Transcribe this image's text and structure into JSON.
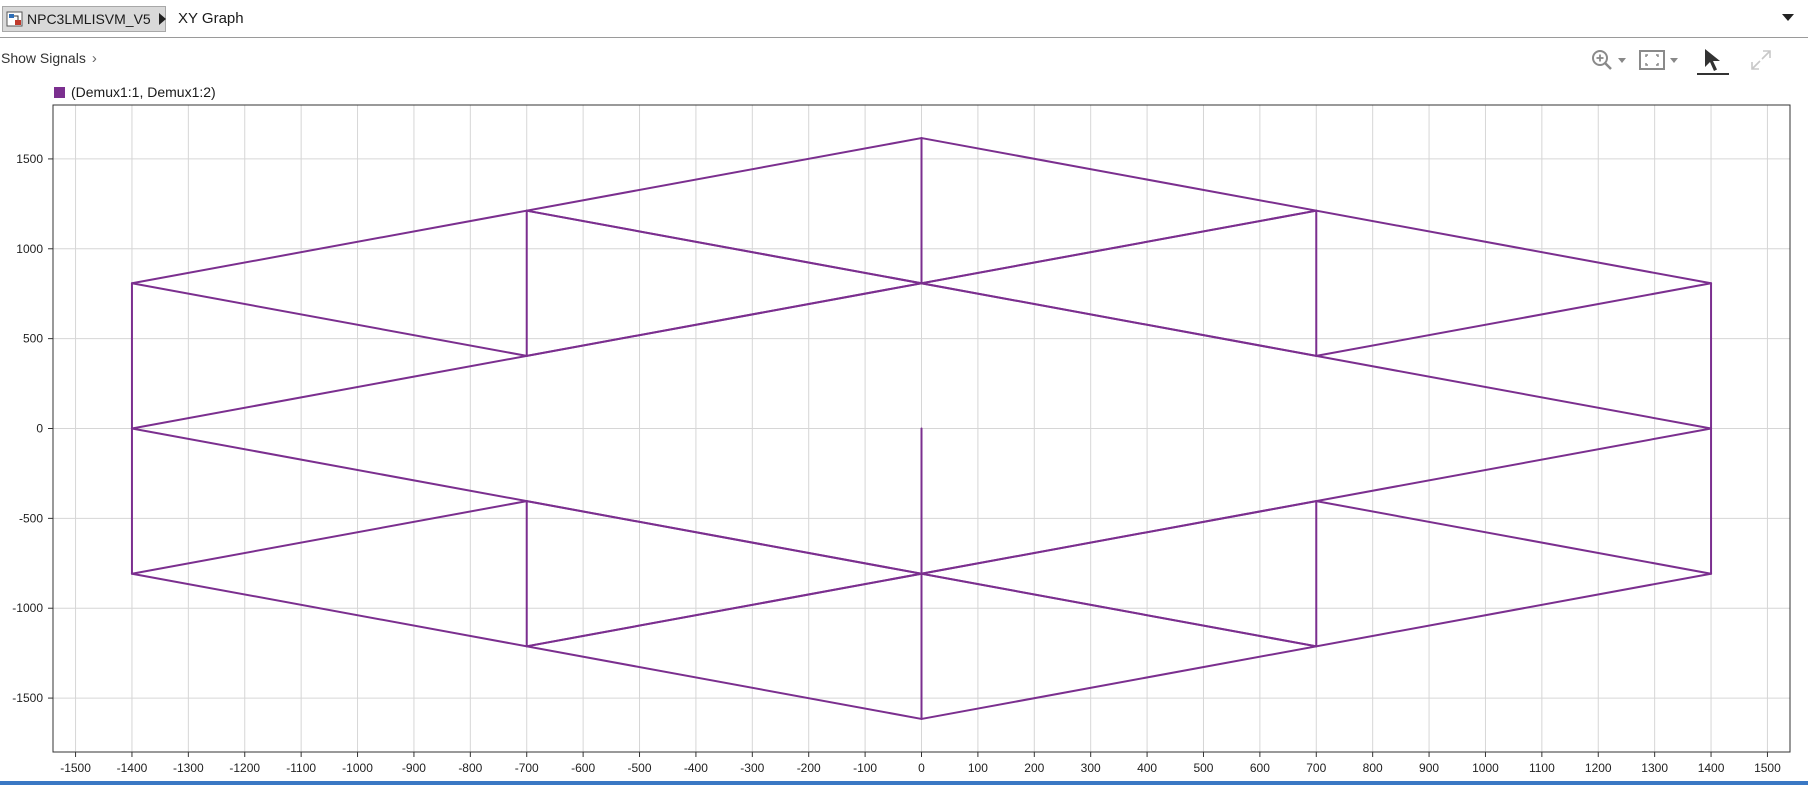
{
  "breadcrumb": {
    "model": "NPC3LMLISVM_V5",
    "block": "XY Graph"
  },
  "toolbar": {
    "show_signals": "Show Signals",
    "chevron": "›",
    "icons": [
      "zoom-in-icon",
      "fit-to-view-icon",
      "pointer-icon",
      "expand-icon"
    ]
  },
  "legend": {
    "label": "(Demux1:1, Demux1:2)",
    "color": "#7b2f8f"
  },
  "colors": {
    "plot_line": "#7b2f8f",
    "grid": "#d6d6d6",
    "accent_bottom": "#3a78c4"
  },
  "chart_data": {
    "type": "line",
    "title": "",
    "xlabel": "",
    "ylabel": "",
    "xlim": [
      -1540,
      1540
    ],
    "ylim": [
      -1800,
      1800
    ],
    "xticks": [
      -1500,
      -1400,
      -1300,
      -1200,
      -1100,
      -1000,
      -900,
      -800,
      -700,
      -600,
      -500,
      -400,
      -300,
      -200,
      -100,
      0,
      100,
      200,
      300,
      400,
      500,
      600,
      700,
      800,
      900,
      1000,
      1100,
      1200,
      1300,
      1400,
      1500
    ],
    "yticks": [
      -1500,
      -1000,
      -500,
      0,
      500,
      1000,
      1500
    ],
    "grid": true,
    "legend_position": "top-left",
    "series": [
      {
        "name": "(Demux1:1, Demux1:2)",
        "segments": [
          [
            [
              -1400,
              808
            ],
            [
              0,
              1616
            ]
          ],
          [
            [
              0,
              1616
            ],
            [
              1400,
              808
            ]
          ],
          [
            [
              1400,
              808
            ],
            [
              1400,
              -808
            ]
          ],
          [
            [
              1400,
              -808
            ],
            [
              0,
              -1616
            ]
          ],
          [
            [
              0,
              -1616
            ],
            [
              -1400,
              -808
            ]
          ],
          [
            [
              -1400,
              -808
            ],
            [
              -1400,
              808
            ]
          ],
          [
            [
              -700,
              1212
            ],
            [
              700,
              404
            ]
          ],
          [
            [
              700,
              1212
            ],
            [
              -700,
              404
            ]
          ],
          [
            [
              -700,
              -404
            ],
            [
              700,
              -1212
            ]
          ],
          [
            [
              700,
              -404
            ],
            [
              -700,
              -1212
            ]
          ],
          [
            [
              -1400,
              0
            ],
            [
              700,
              1212
            ]
          ],
          [
            [
              1400,
              0
            ],
            [
              -700,
              1212
            ]
          ],
          [
            [
              -1400,
              0
            ],
            [
              700,
              -1212
            ]
          ],
          [
            [
              1400,
              0
            ],
            [
              -700,
              -1212
            ]
          ],
          [
            [
              -700,
              1212
            ],
            [
              -700,
              404
            ]
          ],
          [
            [
              700,
              1212
            ],
            [
              700,
              404
            ]
          ],
          [
            [
              -700,
              -404
            ],
            [
              -700,
              -1212
            ]
          ],
          [
            [
              700,
              -404
            ],
            [
              700,
              -1212
            ]
          ],
          [
            [
              0,
              1616
            ],
            [
              0,
              808
            ]
          ],
          [
            [
              0,
              0
            ],
            [
              0,
              -1616
            ]
          ],
          [
            [
              1400,
              808
            ],
            [
              700,
              404
            ]
          ],
          [
            [
              1400,
              -808
            ],
            [
              700,
              -404
            ]
          ],
          [
            [
              -1400,
              808
            ],
            [
              -700,
              404
            ]
          ],
          [
            [
              -1400,
              -808
            ],
            [
              -700,
              -404
            ]
          ]
        ]
      }
    ]
  }
}
